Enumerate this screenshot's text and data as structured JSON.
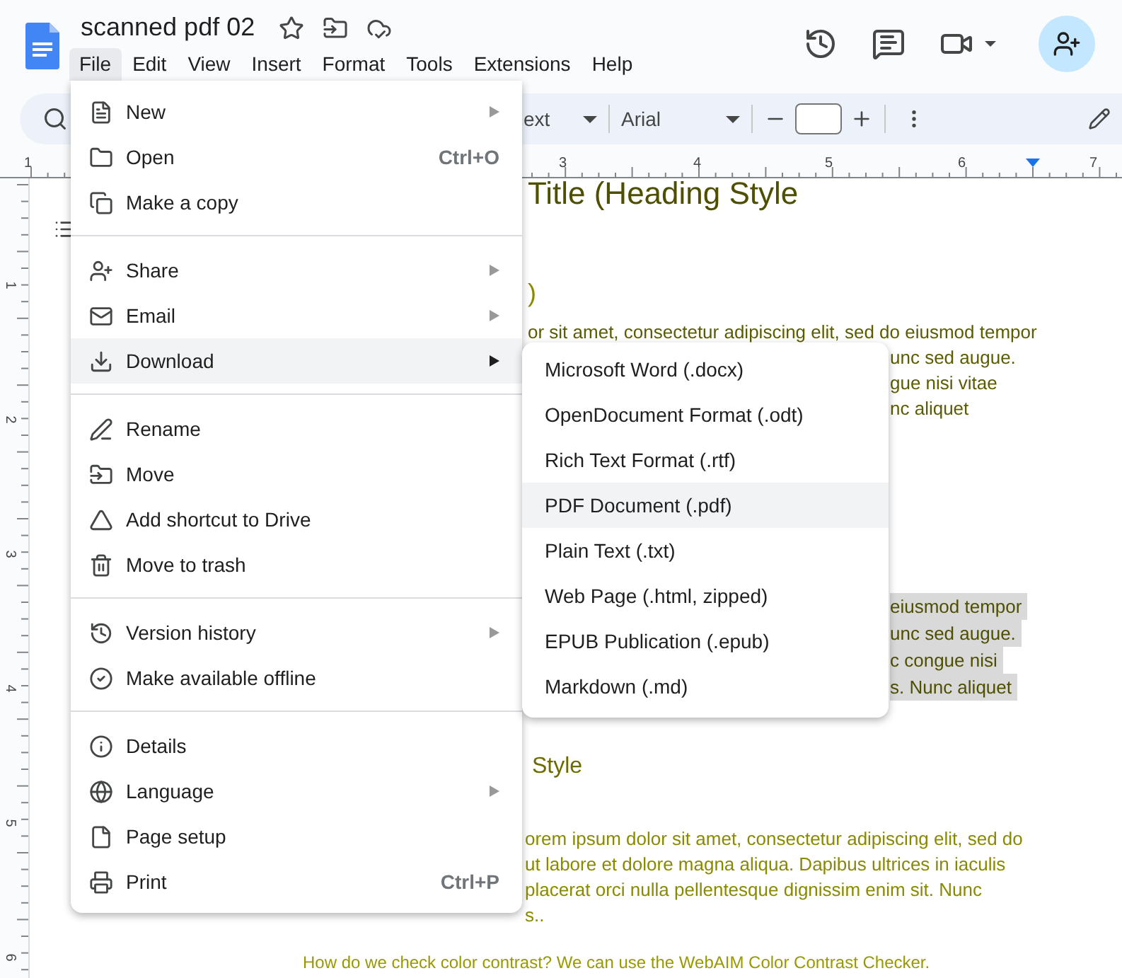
{
  "document": {
    "title": "scanned pdf 02"
  },
  "menu_bar": [
    {
      "label": "File",
      "selected": true
    },
    {
      "label": "Edit",
      "selected": false
    },
    {
      "label": "View",
      "selected": false
    },
    {
      "label": "Insert",
      "selected": false
    },
    {
      "label": "Format",
      "selected": false
    },
    {
      "label": "Tools",
      "selected": false
    },
    {
      "label": "Extensions",
      "selected": false
    },
    {
      "label": "Help",
      "selected": false
    }
  ],
  "toolbar": {
    "style_dropdown": "ext",
    "font_dropdown": "Arial"
  },
  "ruler": {
    "top_numbers": [
      "1",
      "3",
      "4",
      "5",
      "6",
      "7"
    ],
    "side_numbers": [
      "1",
      "2",
      "3",
      "4",
      "5",
      "6"
    ]
  },
  "file_menu": {
    "sections": [
      [
        {
          "label": "New",
          "has_submenu": true,
          "selected": false
        },
        {
          "label": "Open",
          "shortcut": "Ctrl+O",
          "has_submenu": false,
          "selected": false
        },
        {
          "label": "Make a copy",
          "has_submenu": false,
          "selected": false
        }
      ],
      [
        {
          "label": "Share",
          "has_submenu": true,
          "selected": false
        },
        {
          "label": "Email",
          "has_submenu": true,
          "selected": false
        },
        {
          "label": "Download",
          "has_submenu": true,
          "selected": true
        }
      ],
      [
        {
          "label": "Rename",
          "has_submenu": false,
          "selected": false
        },
        {
          "label": "Move",
          "has_submenu": false,
          "selected": false
        },
        {
          "label": "Add shortcut to Drive",
          "has_submenu": false,
          "selected": false
        },
        {
          "label": "Move to trash",
          "has_submenu": false,
          "selected": false
        }
      ],
      [
        {
          "label": "Version history",
          "has_submenu": true,
          "selected": false
        },
        {
          "label": "Make available offline",
          "has_submenu": false,
          "selected": false
        }
      ],
      [
        {
          "label": "Details",
          "has_submenu": false,
          "selected": false
        },
        {
          "label": "Language",
          "has_submenu": true,
          "selected": false
        },
        {
          "label": "Page setup",
          "has_submenu": false,
          "selected": false
        },
        {
          "label": "Print",
          "shortcut": "Ctrl+P",
          "has_submenu": false,
          "selected": false
        }
      ]
    ]
  },
  "download_submenu": [
    {
      "label": "Microsoft Word (.docx)",
      "selected": false
    },
    {
      "label": "OpenDocument Format (.odt)",
      "selected": false
    },
    {
      "label": "Rich Text Format (.rtf)",
      "selected": false
    },
    {
      "label": "PDF Document (.pdf)",
      "selected": true
    },
    {
      "label": "Plain Text (.txt)",
      "selected": false
    },
    {
      "label": "Web Page (.html, zipped)",
      "selected": false
    },
    {
      "label": "EPUB Publication (.epub)",
      "selected": false
    },
    {
      "label": "Markdown (.md)",
      "selected": false
    }
  ],
  "page": [
    {
      "kind": "title",
      "text": "Title (Heading Style"
    },
    {
      "kind": "heading",
      "text": ")"
    },
    {
      "kind": "body",
      "text": "or sit amet, consectetur adipiscing elit, sed do eiusmod tempor"
    },
    {
      "kind": "body-right",
      "text": "unc sed augue."
    },
    {
      "kind": "body-right",
      "text": "gue nisi vitae"
    },
    {
      "kind": "body-right",
      "text": "nc aliquet"
    },
    {
      "kind": "highlighted",
      "text": "eiusmod tempor"
    },
    {
      "kind": "highlighted",
      "text": "unc sed augue."
    },
    {
      "kind": "highlighted",
      "text": "c congue nisi"
    },
    {
      "kind": "highlighted",
      "text": "s. Nunc aliquet"
    },
    {
      "kind": "subheading",
      "text": "Style"
    },
    {
      "kind": "light-body",
      "text": "orem ipsum dolor sit amet, consectetur adipiscing elit, sed do"
    },
    {
      "kind": "light-body",
      "text": "ut labore et dolore magna aliqua. Dapibus ultrices in iaculis"
    },
    {
      "kind": "light-body",
      "text": "placerat orci nulla pellentesque dignissim enim sit. Nunc"
    },
    {
      "kind": "light-body",
      "text": "s.."
    },
    {
      "kind": "caption",
      "text": "How do we check color contrast? We can use the WebAIM Color Contrast Checker."
    }
  ]
}
